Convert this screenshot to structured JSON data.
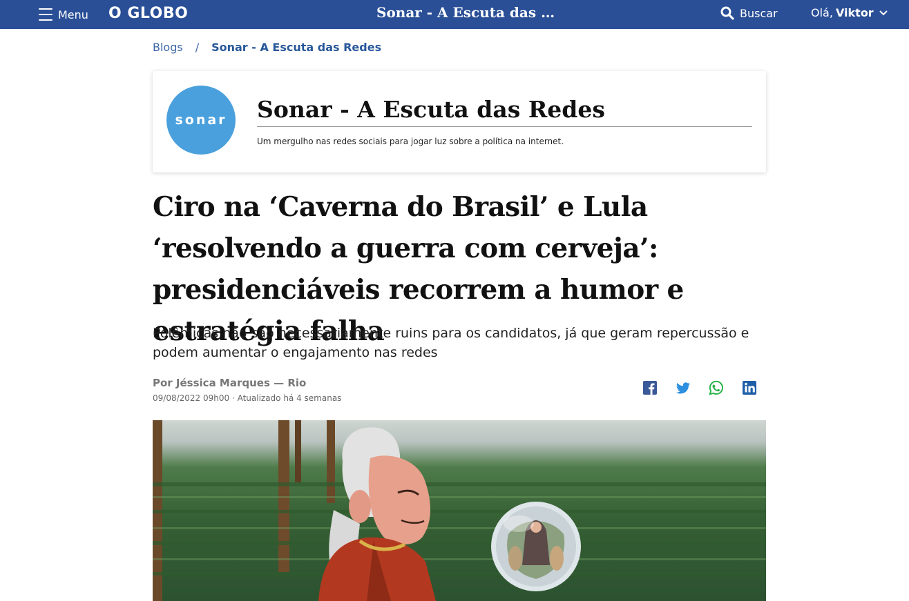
{
  "nav": {
    "menu_label": "Menu",
    "logo": "O GLOBO",
    "title": "Sonar - A Escuta das …",
    "search_label": "Buscar",
    "greeting": "Olá, ",
    "user_name": "Viktor"
  },
  "breadcrumb": {
    "root": "Blogs",
    "separator": "/",
    "current": "Sonar - A Escuta das Redes"
  },
  "blog": {
    "logo_text": "sonar",
    "title": "Sonar - A Escuta das Redes",
    "description": "Um mergulho nas redes sociais para jogar luz sobre a política na internet."
  },
  "article": {
    "headline": "Ciro na ‘Caverna do Brasil’ e Lula ‘resolvendo a guerra com cerveja’: presidenciáveis recorrem a humor e estratégia falha",
    "subhead": "Polêmicas não são necessariamente ruins para os candidatos, já que geram repercussão e podem aumentar o engajamento nas redes",
    "byline": "Por Jéssica Marques — Rio",
    "dateline": "09/08/2022 09h00 · Atualizado há 4 semanas"
  },
  "share": {
    "icons": [
      "facebook-icon",
      "twitter-icon",
      "whatsapp-icon",
      "linkedin-icon"
    ]
  },
  "colors": {
    "nav_bg": "#2a4f97",
    "link": "#3c67a7",
    "sonar_blue": "#4aa0dc",
    "facebook": "#3b5998",
    "twitter": "#1da1f2",
    "whatsapp": "#25d366",
    "linkedin": "#0a66c2"
  }
}
